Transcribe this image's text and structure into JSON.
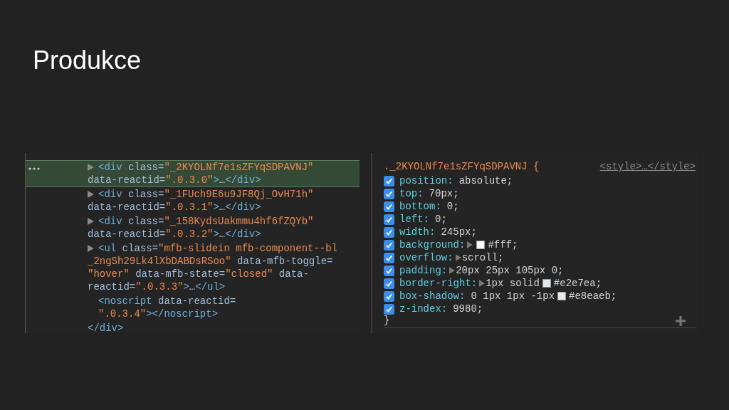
{
  "slide": {
    "title": "Produkce"
  },
  "elements_panel": {
    "nodes": [
      {
        "kind": "collapsible",
        "selected": true,
        "lines": [
          [
            {
              "kind": "tag",
              "text": "<div"
            },
            {
              "kind": "attr",
              "text": " class="
            },
            {
              "kind": "value",
              "text": "\"_2KYOLNf7e1sZFYqSDPAVNJ\""
            }
          ],
          [
            {
              "kind": "attr",
              "text": "data-reactid="
            },
            {
              "kind": "value",
              "text": "\".0.3.0\""
            },
            {
              "kind": "tag",
              "text": ">"
            },
            {
              "kind": "text",
              "text": "…"
            },
            {
              "kind": "tag",
              "text": "</div>"
            }
          ]
        ]
      },
      {
        "kind": "collapsible",
        "selected": false,
        "lines": [
          [
            {
              "kind": "tag",
              "text": "<div"
            },
            {
              "kind": "attr",
              "text": " class="
            },
            {
              "kind": "value",
              "text": "\"_1FUch9E6u9JF8Qj_OvH71h\""
            }
          ],
          [
            {
              "kind": "attr",
              "text": "data-reactid="
            },
            {
              "kind": "value",
              "text": "\".0.3.1\""
            },
            {
              "kind": "tag",
              "text": ">"
            },
            {
              "kind": "text",
              "text": "…"
            },
            {
              "kind": "tag",
              "text": "</div>"
            }
          ]
        ]
      },
      {
        "kind": "collapsible",
        "selected": false,
        "lines": [
          [
            {
              "kind": "tag",
              "text": "<div"
            },
            {
              "kind": "attr",
              "text": " class="
            },
            {
              "kind": "value",
              "text": "\"_158KydsUakmmu4hf6fZQYb\""
            }
          ],
          [
            {
              "kind": "attr",
              "text": "data-reactid="
            },
            {
              "kind": "value",
              "text": "\".0.3.2\""
            },
            {
              "kind": "tag",
              "text": ">"
            },
            {
              "kind": "text",
              "text": "…"
            },
            {
              "kind": "tag",
              "text": "</div>"
            }
          ]
        ]
      },
      {
        "kind": "collapsible",
        "selected": false,
        "lines": [
          [
            {
              "kind": "tag",
              "text": "<ul"
            },
            {
              "kind": "attr",
              "text": " class="
            },
            {
              "kind": "value",
              "text": "\"mfb-slidein mfb-component--bl"
            }
          ],
          [
            {
              "kind": "value",
              "text": "_2ngSh29Lk4lXbDABDsRSoo\""
            },
            {
              "kind": "attr",
              "text": " data-mfb-toggle="
            }
          ],
          [
            {
              "kind": "value",
              "text": "\"hover\""
            },
            {
              "kind": "attr",
              "text": " data-mfb-state="
            },
            {
              "kind": "value",
              "text": "\"closed\""
            },
            {
              "kind": "attr",
              "text": " data-"
            }
          ],
          [
            {
              "kind": "attr",
              "text": "reactid="
            },
            {
              "kind": "value",
              "text": "\".0.3.3\""
            },
            {
              "kind": "tag",
              "text": ">"
            },
            {
              "kind": "text",
              "text": "…"
            },
            {
              "kind": "tag",
              "text": "</ul>"
            }
          ]
        ]
      },
      {
        "kind": "leaf",
        "selected": false,
        "lines": [
          [
            {
              "kind": "tag",
              "text": "<noscript"
            },
            {
              "kind": "attr",
              "text": " data-reactid="
            }
          ],
          [
            {
              "kind": "value",
              "text": "\".0.3.4\""
            },
            {
              "kind": "tag",
              "text": "></noscript>"
            }
          ]
        ]
      },
      {
        "kind": "closing",
        "selected": false,
        "lines": [
          [
            {
              "kind": "tag",
              "text": "</div>"
            }
          ]
        ]
      }
    ]
  },
  "styles_panel": {
    "selector": "._2KYOLNf7e1sZFYqSDPAVNJ {",
    "source": "<style>…</style>",
    "declarations": [
      {
        "checked": true,
        "property": "position:",
        "expandable": false,
        "parts": [
          {
            "kind": "text",
            "text": "absolute;"
          }
        ]
      },
      {
        "checked": true,
        "property": "top:",
        "expandable": false,
        "parts": [
          {
            "kind": "text",
            "text": "70px;"
          }
        ]
      },
      {
        "checked": true,
        "property": "bottom:",
        "expandable": false,
        "parts": [
          {
            "kind": "text",
            "text": "0;"
          }
        ]
      },
      {
        "checked": true,
        "property": "left:",
        "expandable": false,
        "parts": [
          {
            "kind": "text",
            "text": "0;"
          }
        ]
      },
      {
        "checked": true,
        "property": "width:",
        "expandable": false,
        "parts": [
          {
            "kind": "text",
            "text": "245px;"
          }
        ]
      },
      {
        "checked": true,
        "property": "background:",
        "expandable": true,
        "parts": [
          {
            "kind": "swatch",
            "color": "#ffffff"
          },
          {
            "kind": "text",
            "text": "#fff;"
          }
        ]
      },
      {
        "checked": true,
        "property": "overflow:",
        "expandable": true,
        "parts": [
          {
            "kind": "text",
            "text": "scroll;"
          }
        ]
      },
      {
        "checked": true,
        "property": "padding:",
        "expandable": true,
        "parts": [
          {
            "kind": "text",
            "text": "20px 25px 105px 0;"
          }
        ]
      },
      {
        "checked": true,
        "property": "border-right:",
        "expandable": true,
        "parts": [
          {
            "kind": "text",
            "text": "1px solid"
          },
          {
            "kind": "swatch",
            "color": "#e2e7ea"
          },
          {
            "kind": "text",
            "text": "#e2e7ea;"
          }
        ]
      },
      {
        "checked": true,
        "property": "box-shadow:",
        "expandable": false,
        "parts": [
          {
            "kind": "text",
            "text": "0 1px 1px -1px"
          },
          {
            "kind": "swatch",
            "color": "#e8eaeb"
          },
          {
            "kind": "text",
            "text": "#e8eaeb;"
          }
        ]
      },
      {
        "checked": true,
        "property": "z-index:",
        "expandable": false,
        "parts": [
          {
            "kind": "text",
            "text": "9980;"
          }
        ]
      }
    ],
    "closing": "}"
  }
}
